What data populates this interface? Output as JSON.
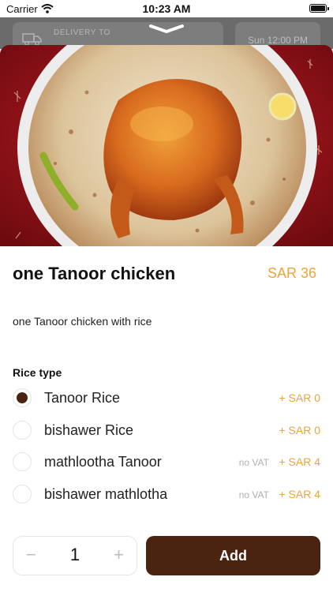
{
  "status_bar": {
    "carrier": "Carrier",
    "time": "10:23 AM"
  },
  "header": {
    "delivery_label": "DELIVERY TO",
    "time_label": "Sun 12:00 PM"
  },
  "product": {
    "name": "one Tanoor chicken",
    "price": "SAR 36",
    "description": "one Tanoor chicken with rice"
  },
  "options_group": {
    "label": "Rice type",
    "items": [
      {
        "name": "Tanoor Rice",
        "vat_note": "",
        "price": "+ SAR 0",
        "selected": true
      },
      {
        "name": "bishawer Rice",
        "vat_note": "",
        "price": "+ SAR 0",
        "selected": false
      },
      {
        "name": "mathlootha Tanoor",
        "vat_note": "no VAT",
        "price": "+ SAR 4",
        "selected": false
      },
      {
        "name": "bishawer mathlotha",
        "vat_note": "no VAT",
        "price": "+ SAR 4",
        "selected": false
      }
    ]
  },
  "quantity": {
    "minus": "−",
    "value": "1",
    "plus": "+"
  },
  "add_button": {
    "label": "Add"
  },
  "colors": {
    "accent": "#eea43a",
    "brand_dark": "#4a2410",
    "hero_background": "#a8141c"
  }
}
